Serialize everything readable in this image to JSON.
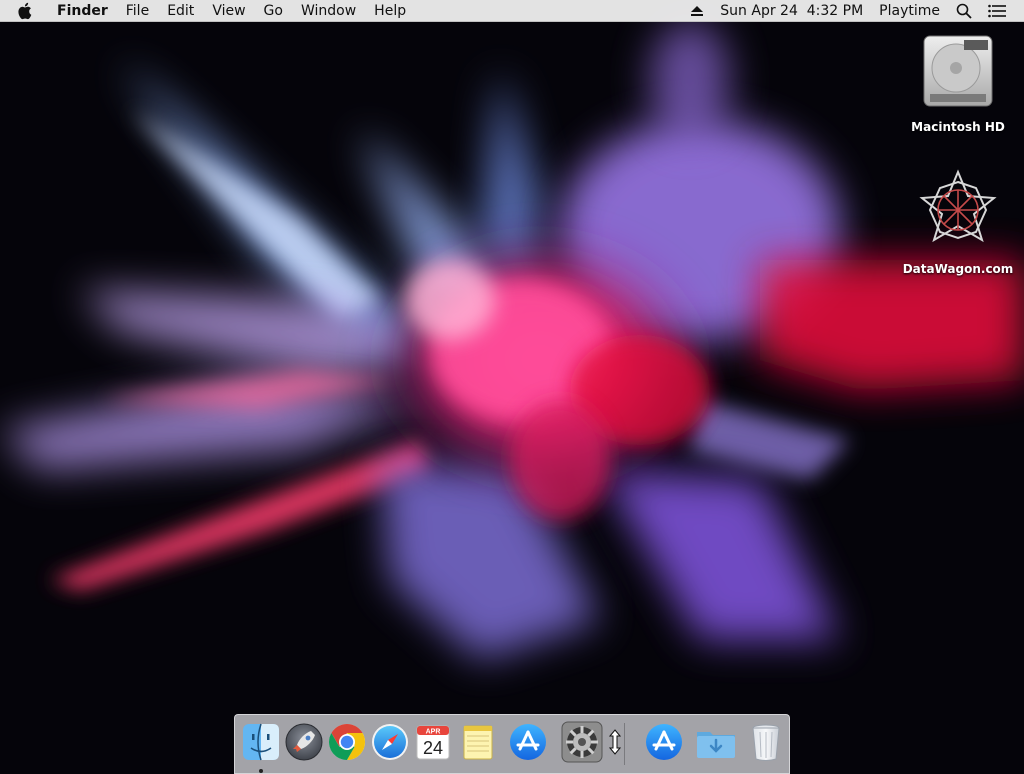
{
  "menubar": {
    "app_name": "Finder",
    "menus": [
      "File",
      "Edit",
      "View",
      "Go",
      "Window",
      "Help"
    ],
    "clock": "Sun Apr 24  4:32 PM",
    "user": "Playtime"
  },
  "desktop": {
    "icons": [
      {
        "label": "Macintosh HD",
        "icon": "hard-drive-icon"
      },
      {
        "label": "DataWagon.com",
        "icon": "datawagon-star-icon"
      }
    ]
  },
  "dock": {
    "apps": [
      {
        "name": "finder",
        "icon": "finder-icon",
        "running": true
      },
      {
        "name": "launchpad",
        "icon": "launchpad-rocket-icon",
        "running": false
      },
      {
        "name": "chrome",
        "icon": "chrome-icon",
        "running": false
      },
      {
        "name": "safari",
        "icon": "safari-compass-icon",
        "running": false
      },
      {
        "name": "calendar",
        "icon": "calendar-icon",
        "running": false
      },
      {
        "name": "notes",
        "icon": "notes-icon",
        "running": false
      },
      {
        "name": "app-store",
        "icon": "app-store-icon",
        "running": false
      },
      {
        "name": "system-preferences",
        "icon": "gear-icon",
        "running": false
      },
      {
        "name": "app-store-2",
        "icon": "app-store-icon",
        "running": false
      },
      {
        "name": "downloads",
        "icon": "downloads-folder-icon",
        "running": false
      },
      {
        "name": "trash",
        "icon": "trash-icon",
        "running": false
      }
    ],
    "calendar": {
      "month": "APR",
      "day": "24"
    }
  },
  "colors": {
    "wallpaper_bg": "#05040a",
    "explosion_pink": "#ff3d8b",
    "explosion_purple": "#8a5cf0",
    "explosion_blue": "#7fa8ff",
    "explosion_red": "#e0103a"
  }
}
